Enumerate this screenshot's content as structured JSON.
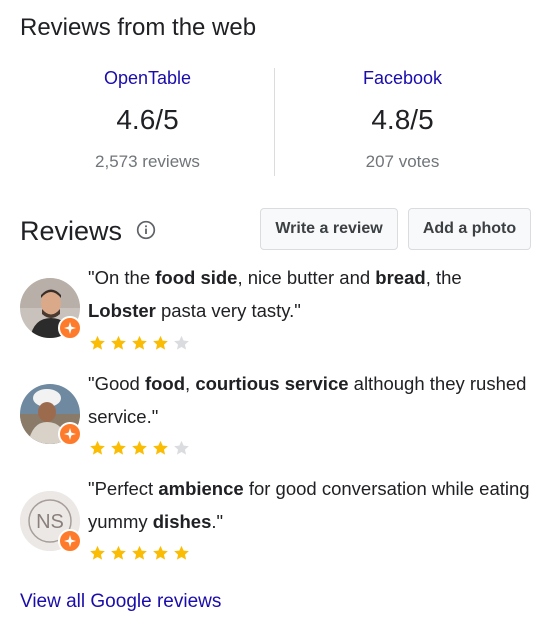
{
  "header": {
    "title": "Reviews from the web"
  },
  "web_reviews": [
    {
      "source": "OpenTable",
      "rating": "4.6/5",
      "count": "2,573 reviews"
    },
    {
      "source": "Facebook",
      "rating": "4.8/5",
      "count": "207 votes"
    }
  ],
  "reviews_section": {
    "title": "Reviews",
    "write_label": "Write a review",
    "photo_label": "Add a photo",
    "items": [
      {
        "parts": [
          "\"On the ",
          "food side",
          ", nice butter and ",
          "bread",
          ", the ",
          "Lobster",
          " pasta very tasty.\""
        ],
        "stars": 4
      },
      {
        "parts": [
          "\"Good ",
          "food",
          ", ",
          "courtious service",
          " although they rushed service.\""
        ],
        "stars": 4
      },
      {
        "parts": [
          "\"Perfect ",
          "ambience",
          " for good conversation while eating yummy ",
          "dishes",
          ".\""
        ],
        "stars": 5,
        "avatar_initials": "NS"
      }
    ],
    "view_all": "View all Google reviews"
  },
  "colors": {
    "link": "#1a0dab",
    "star_filled": "#fbbc04",
    "star_empty": "#dadce0",
    "badge": "#ff7b2c"
  }
}
